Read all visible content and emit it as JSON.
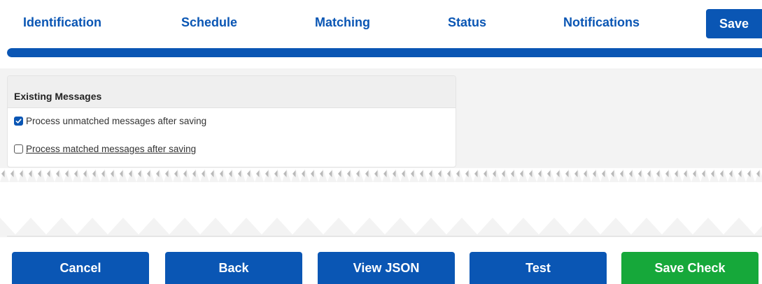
{
  "nav": {
    "tabs": [
      {
        "label": "Identification"
      },
      {
        "label": "Schedule"
      },
      {
        "label": "Matching"
      },
      {
        "label": "Status"
      },
      {
        "label": "Notifications"
      }
    ],
    "save_label": "Save"
  },
  "progress": {
    "fraction": 1.0
  },
  "existing_messages": {
    "title": "Existing Messages",
    "options": [
      {
        "label": "Process unmatched messages after saving",
        "checked": true
      },
      {
        "label": "Process matched messages after saving",
        "checked": false
      }
    ]
  },
  "footer": {
    "cancel_label": "Cancel",
    "back_label": "Back",
    "view_json_label": "View JSON",
    "test_label": "Test",
    "save_check_label": "Save Check"
  },
  "colors": {
    "primary": "#0a56b4",
    "success": "#16a83a",
    "text": "#333333"
  }
}
